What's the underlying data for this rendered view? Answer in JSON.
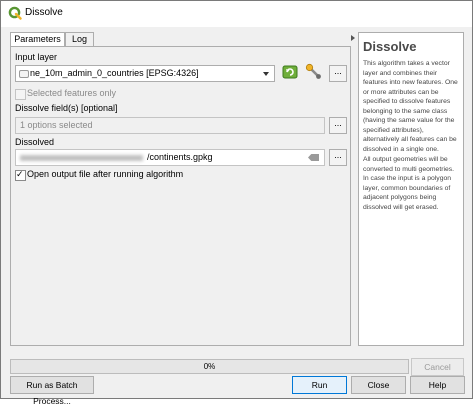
{
  "window": {
    "title": "Dissolve"
  },
  "tabs": [
    {
      "label": "Parameters"
    },
    {
      "label": "Log"
    }
  ],
  "params": {
    "input_layer": {
      "label": "Input layer",
      "value": "ne_10m_admin_0_countries [EPSG:4326]"
    },
    "selected_only": {
      "label": "Selected features only",
      "checked": false
    },
    "dissolve_fields": {
      "label": "Dissolve field(s) [optional]",
      "value": "1 options selected"
    },
    "dissolved": {
      "label": "Dissolved",
      "value_suffix": "/continents.gpkg"
    },
    "open_output": {
      "label": "Open output file after running algorithm",
      "checked": true
    },
    "browse_label": "..."
  },
  "help": {
    "heading": "Dissolve",
    "paragraphs": [
      "This algorithm takes a vector layer and combines their features into new features. One or more attributes can be specified to dissolve features belonging to the same class (having the same value for the specified attributes), alternatively all features can be dissolved in a single one.",
      "All output geometries will be converted to multi geometries. In case the input is a polygon layer, common boundaries of adjacent polygons being dissolved will get erased."
    ]
  },
  "progress": {
    "value": 0,
    "text": "0%"
  },
  "buttons": {
    "cancel": "Cancel",
    "batch": "Run as Batch Process...",
    "run": "Run",
    "close": "Close",
    "help": "Help"
  },
  "icons": [
    "qgis-logo-icon",
    "layer-icon",
    "iterate-icon",
    "wrench-icon",
    "clear-field-icon",
    "checkbox-icon"
  ],
  "colors": {
    "accent_blue": "#0078d7",
    "qgis_green": "#589632",
    "help_heading": "#4a4a4a"
  }
}
